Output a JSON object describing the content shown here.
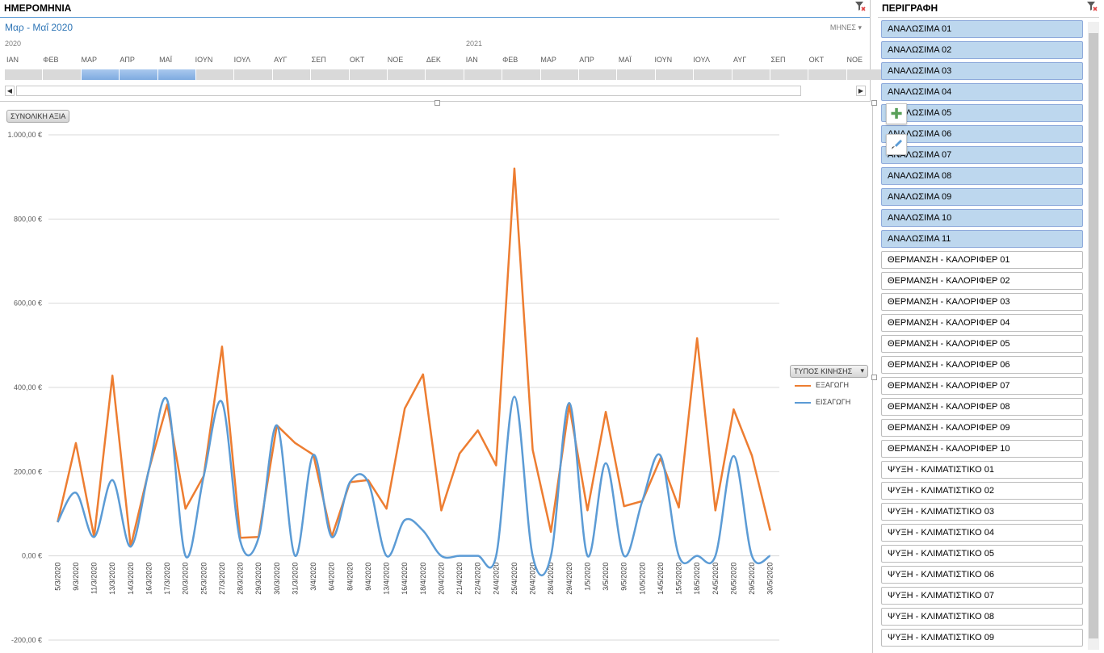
{
  "timeline": {
    "title": "ΗΜΕΡΟΜΗΝΙΑ",
    "range": "Μαρ - Μαΐ 2020",
    "level": "ΜΗΝΕΣ",
    "year1": "2020",
    "year2": "2021",
    "months": [
      "ΙΑΝ",
      "ΦΕΒ",
      "ΜΑΡ",
      "ΑΠΡ",
      "ΜΑΪ",
      "ΙΟΥΝ",
      "ΙΟΥΛ",
      "ΑΥΓ",
      "ΣΕΠ",
      "ΟΚΤ",
      "ΝΟΕ",
      "ΔΕΚ",
      "ΙΑΝ",
      "ΦΕΒ",
      "ΜΑΡ",
      "ΑΠΡ",
      "ΜΑΪ",
      "ΙΟΥΝ",
      "ΙΟΥΛ",
      "ΑΥΓ",
      "ΣΕΠ",
      "ΟΚΤ",
      "ΝΟΕ"
    ],
    "selected": [
      2,
      3,
      4
    ]
  },
  "chart_data": {
    "type": "line",
    "value_field": "ΣΥΝΟΛΙΚΗ ΑΞΙΑ",
    "legend_title": "ΤΥΠΟΣ ΚΙΝΗΣΗΣ",
    "legend_position": "right",
    "grid": true,
    "ylim": [
      -200,
      1000
    ],
    "yticks": [
      "-200,00 €",
      "0,00 €",
      "200,00 €",
      "400,00 €",
      "600,00 €",
      "800,00 €",
      "1.000,00 €"
    ],
    "ytick_values": [
      -200,
      0,
      200,
      400,
      600,
      800,
      1000
    ],
    "categories": [
      "5/3/2020",
      "9/3/2020",
      "11/3/2020",
      "13/3/2020",
      "14/3/2020",
      "16/3/2020",
      "17/3/2020",
      "20/3/2020",
      "25/3/2020",
      "27/3/2020",
      "28/3/2020",
      "29/3/2020",
      "30/3/2020",
      "31/3/2020",
      "3/4/2020",
      "6/4/2020",
      "8/4/2020",
      "9/4/2020",
      "13/4/2020",
      "16/4/2020",
      "18/4/2020",
      "20/4/2020",
      "21/4/2020",
      "22/4/2020",
      "24/4/2020",
      "25/4/2020",
      "26/4/2020",
      "28/4/2020",
      "29/4/2020",
      "1/5/2020",
      "3/5/2020",
      "9/5/2020",
      "10/5/2020",
      "14/5/2020",
      "15/5/2020",
      "18/5/2020",
      "24/5/2020",
      "26/5/2020",
      "29/5/2020",
      "30/5/2020"
    ],
    "series": [
      {
        "name": "ΕΞΑΓΩΓΗ",
        "color": "#ed7d31",
        "values": [
          80,
          268,
          45,
          428,
          22,
          205,
          360,
          112,
          190,
          497,
          43,
          45,
          310,
          268,
          240,
          45,
          175,
          180,
          112,
          350,
          431,
          108,
          243,
          298,
          215,
          920,
          252,
          57,
          358,
          108,
          342,
          118,
          130,
          232,
          115,
          517,
          108,
          348,
          238,
          60
        ]
      },
      {
        "name": "ΕΙΣΑΓΩΓΗ",
        "color": "#5b9bd5",
        "values": [
          80,
          150,
          45,
          180,
          22,
          205,
          370,
          0,
          190,
          365,
          35,
          43,
          310,
          0,
          240,
          45,
          175,
          175,
          0,
          85,
          60,
          0,
          0,
          0,
          0,
          378,
          0,
          0,
          363,
          0,
          220,
          0,
          130,
          238,
          0,
          0,
          0,
          237,
          0,
          0
        ]
      }
    ]
  },
  "description": {
    "title": "ΠΕΡΙΓΡΑΦΗ",
    "items": [
      {
        "label": "ΑΝΑΛΩΣΙΜΑ 01",
        "selected": true
      },
      {
        "label": "ΑΝΑΛΩΣΙΜΑ 02",
        "selected": true
      },
      {
        "label": "ΑΝΑΛΩΣΙΜΑ 03",
        "selected": true
      },
      {
        "label": "ΑΝΑΛΩΣΙΜΑ 04",
        "selected": true
      },
      {
        "label": "ΑΝΑΛΩΣΙΜΑ 05",
        "selected": true
      },
      {
        "label": "ΑΝΑΛΩΣΙΜΑ 06",
        "selected": true
      },
      {
        "label": "ΑΝΑΛΩΣΙΜΑ 07",
        "selected": true
      },
      {
        "label": "ΑΝΑΛΩΣΙΜΑ 08",
        "selected": true
      },
      {
        "label": "ΑΝΑΛΩΣΙΜΑ 09",
        "selected": true
      },
      {
        "label": "ΑΝΑΛΩΣΙΜΑ 10",
        "selected": true
      },
      {
        "label": "ΑΝΑΛΩΣΙΜΑ 11",
        "selected": true
      },
      {
        "label": "ΘΕΡΜΑΝΣΗ - ΚΑΛΟΡΙΦΕΡ 01",
        "selected": false
      },
      {
        "label": "ΘΕΡΜΑΝΣΗ - ΚΑΛΟΡΙΦΕΡ 02",
        "selected": false
      },
      {
        "label": "ΘΕΡΜΑΝΣΗ - ΚΑΛΟΡΙΦΕΡ 03",
        "selected": false
      },
      {
        "label": "ΘΕΡΜΑΝΣΗ - ΚΑΛΟΡΙΦΕΡ 04",
        "selected": false
      },
      {
        "label": "ΘΕΡΜΑΝΣΗ - ΚΑΛΟΡΙΦΕΡ 05",
        "selected": false
      },
      {
        "label": "ΘΕΡΜΑΝΣΗ - ΚΑΛΟΡΙΦΕΡ 06",
        "selected": false
      },
      {
        "label": "ΘΕΡΜΑΝΣΗ - ΚΑΛΟΡΙΦΕΡ 07",
        "selected": false
      },
      {
        "label": "ΘΕΡΜΑΝΣΗ - ΚΑΛΟΡΙΦΕΡ 08",
        "selected": false
      },
      {
        "label": "ΘΕΡΜΑΝΣΗ - ΚΑΛΟΡΙΦΕΡ 09",
        "selected": false
      },
      {
        "label": "ΘΕΡΜΑΝΣΗ - ΚΑΛΟΡΙΦΕΡ 10",
        "selected": false
      },
      {
        "label": "ΨΥΞΗ - ΚΛΙΜΑΤΙΣΤΙΚΟ 01",
        "selected": false
      },
      {
        "label": "ΨΥΞΗ - ΚΛΙΜΑΤΙΣΤΙΚΟ 02",
        "selected": false
      },
      {
        "label": "ΨΥΞΗ - ΚΛΙΜΑΤΙΣΤΙΚΟ 03",
        "selected": false
      },
      {
        "label": "ΨΥΞΗ - ΚΛΙΜΑΤΙΣΤΙΚΟ 04",
        "selected": false
      },
      {
        "label": "ΨΥΞΗ - ΚΛΙΜΑΤΙΣΤΙΚΟ 05",
        "selected": false
      },
      {
        "label": "ΨΥΞΗ - ΚΛΙΜΑΤΙΣΤΙΚΟ 06",
        "selected": false
      },
      {
        "label": "ΨΥΞΗ - ΚΛΙΜΑΤΙΣΤΙΚΟ 07",
        "selected": false
      },
      {
        "label": "ΨΥΞΗ - ΚΛΙΜΑΤΙΣΤΙΚΟ 08",
        "selected": false
      },
      {
        "label": "ΨΥΞΗ - ΚΛΙΜΑΤΙΣΤΙΚΟ 09",
        "selected": false
      }
    ]
  },
  "icons": {
    "clear_filter": "clear-filter-icon",
    "add": "plus-icon",
    "style": "brush-icon"
  }
}
